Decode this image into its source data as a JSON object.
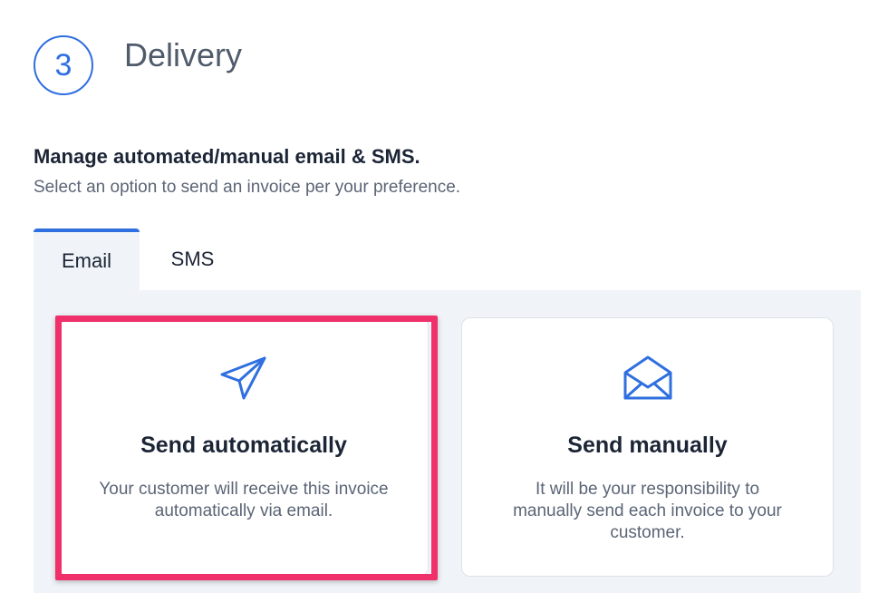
{
  "step": {
    "number": "3",
    "title": "Delivery"
  },
  "section": {
    "heading": "Manage automated/manual email & SMS.",
    "subtext": "Select an option to send an invoice per your preference."
  },
  "tabs": [
    {
      "label": "Email",
      "active": true
    },
    {
      "label": "SMS",
      "active": false
    }
  ],
  "options": [
    {
      "icon": "paper-plane-icon",
      "title": "Send automatically",
      "description": "Your customer will receive this invoice automatically via email.",
      "highlighted": true
    },
    {
      "icon": "envelope-open-icon",
      "title": "Send manually",
      "description": "It will be your responsibility to manually send each invoice to your customer.",
      "highlighted": false
    }
  ],
  "colors": {
    "accent": "#2f6fe0",
    "highlight": "#f0306b",
    "panel_bg": "#f0f4f8"
  }
}
